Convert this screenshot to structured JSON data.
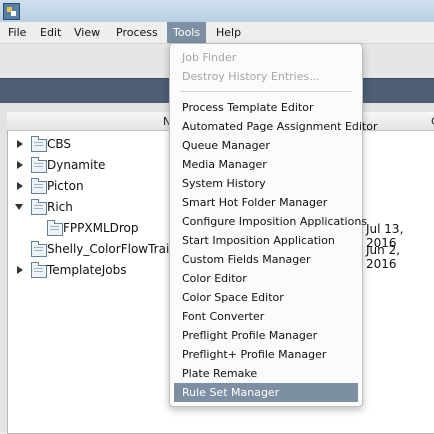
{
  "menubar": {
    "items": [
      "File",
      "Edit",
      "View",
      "Process",
      "Tools",
      "Help"
    ],
    "active": "Tools"
  },
  "table": {
    "col_name_partial": "N",
    "col_date_partial": "C",
    "rows": [
      {
        "label": "CBS",
        "expander": "collapsed",
        "date": ""
      },
      {
        "label": "Dynamite",
        "expander": "collapsed",
        "date": ""
      },
      {
        "label": "Picton",
        "expander": "collapsed",
        "date": ""
      },
      {
        "label": "Rich",
        "expander": "expanded",
        "date": ""
      },
      {
        "label": "FPPXMLDrop",
        "expander": "none",
        "date": "Jul 13, 2016"
      },
      {
        "label": "Shelly_ColorFlowTrain",
        "expander": "none",
        "date": "Jun 2, 2016"
      },
      {
        "label": "TemplateJobs",
        "expander": "collapsed",
        "date": ""
      }
    ]
  },
  "tools_menu": {
    "disabled_items": [
      "Job Finder",
      "Destroy History Entries..."
    ],
    "items": [
      "Process Template Editor",
      "Automated Page Assignment Editor",
      "Queue Manager",
      "Media Manager",
      "System History",
      "Smart Hot Folder Manager",
      "Configure Imposition Applications",
      "Start Imposition Application",
      "Custom Fields Manager",
      "Color Editor",
      "Color Space Editor",
      "Font Converter",
      "Preflight Profile Manager",
      "Preflight+ Profile Manager",
      "Plate Remake",
      "Rule Set Manager"
    ],
    "selected": "Rule Set Manager"
  },
  "colors": {
    "menu_highlight": "#7c8fa3",
    "header_band": "#4d5e75"
  },
  "icons": {
    "app": "app-icon",
    "folder": "folder-icon",
    "expand": "triangle-right-icon",
    "collapse": "triangle-down-icon"
  }
}
